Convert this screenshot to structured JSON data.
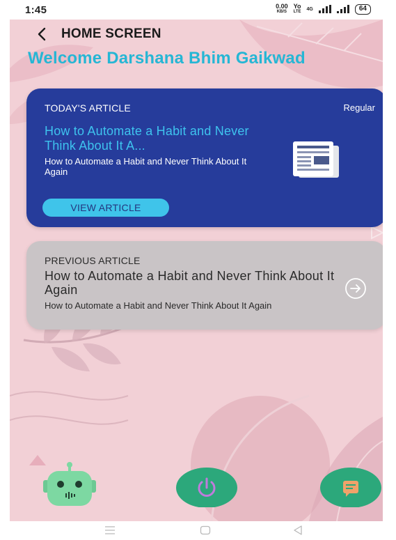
{
  "status_bar": {
    "time": "1:45",
    "net_speed": "0.00",
    "net_speed_unit": "KB/S",
    "volte": "Yo",
    "volte_sub": "LTE",
    "network_type": "4G",
    "battery": "64"
  },
  "header": {
    "title": "HOME SCREEN",
    "back_icon": "chevron-left-icon"
  },
  "welcome": "Welcome Darshana Bhim Gaikwad",
  "todays_article": {
    "label": "TODAY'S ARTICLE",
    "type": "Regular",
    "headline": "How to Automate a Habit and Never Think About It A...",
    "summary": "How to Automate a Habit and Never Think About It Again",
    "button_label": "VIEW ARTICLE",
    "icon": "newspaper-icon"
  },
  "previous_article": {
    "label": "PREVIOUS ARTICLE",
    "headline": "How to Automate a Habit and Never Think About It Again",
    "summary": "How to Automate a Habit and Never Think About It Again",
    "icon": "arrow-right-circle-icon"
  },
  "bottom_actions": {
    "robot_icon": "robot-icon",
    "power_icon": "power-icon",
    "chat_icon": "chat-icon"
  },
  "colors": {
    "background": "#f2d0d6",
    "today_card": "#263c9b",
    "accent": "#3fc4ea",
    "welcome": "#26b6d4",
    "previous_card": "#c9c4c6",
    "action_green": "#2ca87b",
    "robot_green": "#7dd8a2"
  }
}
